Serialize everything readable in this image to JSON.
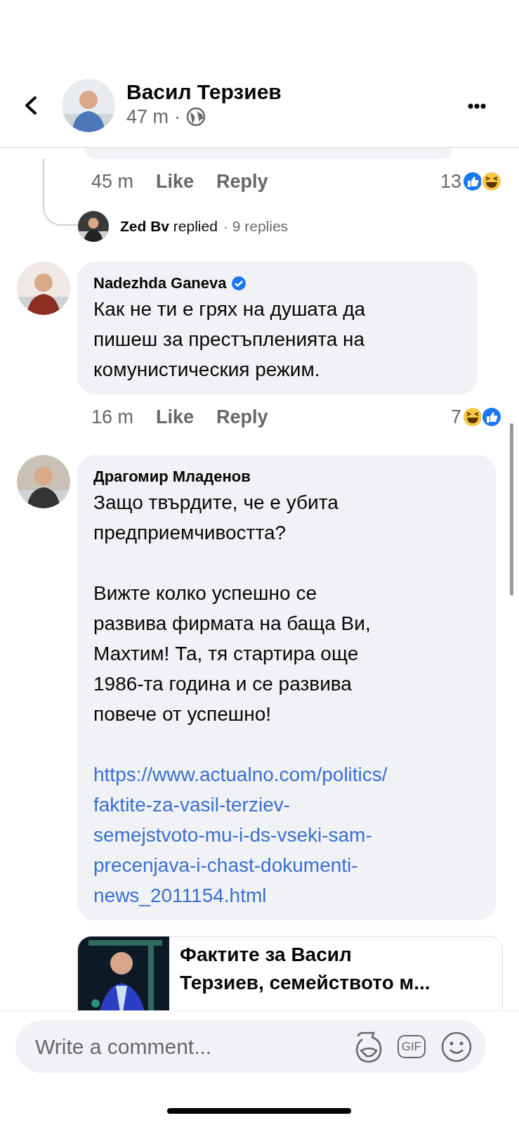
{
  "header": {
    "author": "Васил Терзиев",
    "time": "47 m",
    "separator": "·"
  },
  "previous_comment": {
    "time": "45 m",
    "like": "Like",
    "reply": "Reply",
    "reaction_count": "13",
    "reactions": [
      {
        "kind": "like"
      },
      {
        "kind": "haha"
      }
    ]
  },
  "reply_summary": {
    "text": "**Zed Bv** replied",
    "count": "· 9 replies"
  },
  "comments": [
    {
      "author": "Nadezhda Ganeva",
      "verified": true,
      "paragraphs": [
        {
          "kind": "text",
          "text": "Как не ти е грях на душата да\nпишеш за престъпленията на\nкомунистическия режим."
        }
      ],
      "time": "16 m",
      "like": "Like",
      "reply": "Reply",
      "reaction_count": "7",
      "reactions": [
        {
          "kind": "haha"
        },
        {
          "kind": "like"
        }
      ]
    },
    {
      "author": "Драгомир Младенов",
      "verified": false,
      "paragraphs": [
        {
          "kind": "text",
          "text": "Защо твърдите, че е убита\nпредприемчивостта?"
        },
        {
          "kind": "text",
          "text": "Вижте колко успешно се\nразвива фирмата на баща Ви,\nМахтим! Та, тя стартира още\n1986-та година и се развива\nповече от успешно!"
        },
        {
          "kind": "link",
          "text": "https://www.actualno.com/politics/\nfaktite-za-vasil-terziev-\nsemejstvoto-mu-i-ds-vseki-sam-\nprecenjava-i-chast-dokumenti-\nnews_2011154.html"
        }
      ],
      "preview": {
        "title": "Фактите за Васил\nТерзиев, семейството м..."
      }
    }
  ],
  "composer": {
    "placeholder": "Write a comment...",
    "gif": "GIF"
  }
}
